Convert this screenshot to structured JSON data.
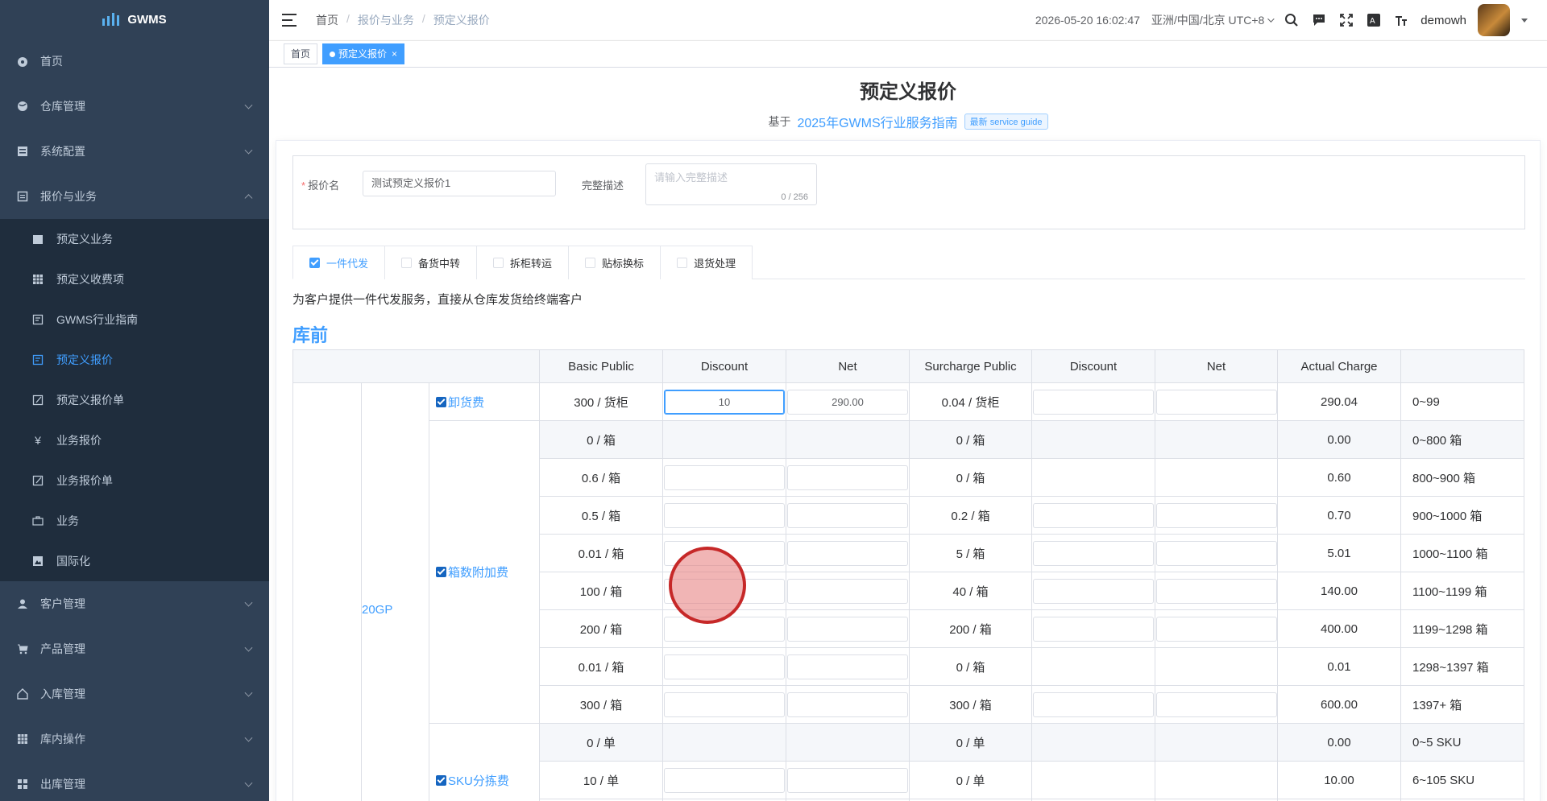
{
  "app": {
    "name": "GWMS"
  },
  "sidebar": {
    "items": [
      {
        "label": "首页",
        "icon": "dashboard-icon"
      },
      {
        "label": "仓库管理",
        "icon": "globe-icon"
      },
      {
        "label": "系统配置",
        "icon": "system-icon"
      },
      {
        "label": "报价与业务",
        "icon": "quote-icon"
      }
    ],
    "sub_items": [
      {
        "label": "预定义业务",
        "icon": "folder-icon"
      },
      {
        "label": "预定义收费项",
        "icon": "table-icon"
      },
      {
        "label": "GWMS行业指南",
        "icon": "guide-icon"
      },
      {
        "label": "预定义报价",
        "icon": "quote-doc-icon"
      },
      {
        "label": "预定义报价单",
        "icon": "edit-icon"
      },
      {
        "label": "业务报价",
        "icon": "yen-icon"
      },
      {
        "label": "业务报价单",
        "icon": "edit-icon"
      },
      {
        "label": "业务",
        "icon": "briefcase-icon"
      },
      {
        "label": "国际化",
        "icon": "image-icon"
      }
    ],
    "items_after": [
      {
        "label": "客户管理",
        "icon": "user-icon"
      },
      {
        "label": "产品管理",
        "icon": "cart-icon"
      },
      {
        "label": "入库管理",
        "icon": "home-icon"
      },
      {
        "label": "库内操作",
        "icon": "grid-icon"
      },
      {
        "label": "出库管理",
        "icon": "apps-icon"
      }
    ]
  },
  "header": {
    "breadcrumb": [
      "首页",
      "报价与业务",
      "预定义报价"
    ],
    "datetime": "2026-05-20 16:02:47",
    "timezone": "亚洲/中国/北京 UTC+8",
    "username": "demowh"
  },
  "tags": {
    "home": "首页",
    "active": "预定义报价"
  },
  "page": {
    "title": "预定义报价",
    "based_on": "基于",
    "guide_name": "2025年GWMS行业服务指南",
    "guide_badge": "最新 service guide"
  },
  "form": {
    "name_label": "报价名",
    "name_value": "测试预定义报价1",
    "desc_label": "完整描述",
    "desc_placeholder": "请输入完整描述",
    "desc_count": "0 / 256"
  },
  "tabs": [
    {
      "label": "一件代发",
      "checked": true
    },
    {
      "label": "备货中转",
      "checked": false
    },
    {
      "label": "拆柜转运",
      "checked": false
    },
    {
      "label": "贴标换标",
      "checked": false
    },
    {
      "label": "退货处理",
      "checked": false
    }
  ],
  "service_desc": "为客户提供一件代发服务，直接从仓库发货给终端客户",
  "section_title": "库前",
  "table": {
    "headers": [
      "Basic Public",
      "Discount",
      "Net",
      "Surcharge Public",
      "Discount",
      "Net",
      "Actual Charge"
    ],
    "container": "20GP",
    "fees": {
      "unload": "卸货费",
      "box": "箱数附加费",
      "sku": "SKU分拣费"
    },
    "unload_row": {
      "basic": "300 / 货柜",
      "discount": "10",
      "net": "290.00",
      "surcharge": "0.04 / 货柜",
      "actual": "290.04",
      "range": "0~99"
    },
    "box_rows": [
      {
        "basic": "0 / 箱",
        "surcharge": "0 / 箱",
        "actual": "0.00",
        "range": "0~800 箱"
      },
      {
        "basic": "0.6 / 箱",
        "surcharge": "0 / 箱",
        "actual": "0.60",
        "range": "800~900 箱"
      },
      {
        "basic": "0.5 / 箱",
        "surcharge": "0.2 / 箱",
        "actual": "0.70",
        "range": "900~1000 箱"
      },
      {
        "basic": "0.01 / 箱",
        "surcharge": "5 / 箱",
        "actual": "5.01",
        "range": "1000~1100 箱"
      },
      {
        "basic": "100 / 箱",
        "surcharge": "40 / 箱",
        "actual": "140.00",
        "range": "1100~1199 箱"
      },
      {
        "basic": "200 / 箱",
        "surcharge": "200 / 箱",
        "actual": "400.00",
        "range": "1199~1298 箱"
      },
      {
        "basic": "0.01 / 箱",
        "surcharge": "0 / 箱",
        "actual": "0.01",
        "range": "1298~1397 箱"
      },
      {
        "basic": "300 / 箱",
        "surcharge": "300 / 箱",
        "actual": "600.00",
        "range": "1397+ 箱"
      }
    ],
    "sku_rows": [
      {
        "basic": "0 / 单",
        "surcharge": "0 / 单",
        "actual": "0.00",
        "range": "0~5 SKU"
      },
      {
        "basic": "10 / 单",
        "surcharge": "0 / 单",
        "actual": "10.00",
        "range": "6~105 SKU"
      }
    ]
  },
  "colors": {
    "sidebar_bg": "#304156",
    "submenu_bg": "#1f2d3d",
    "accent": "#409eff"
  }
}
